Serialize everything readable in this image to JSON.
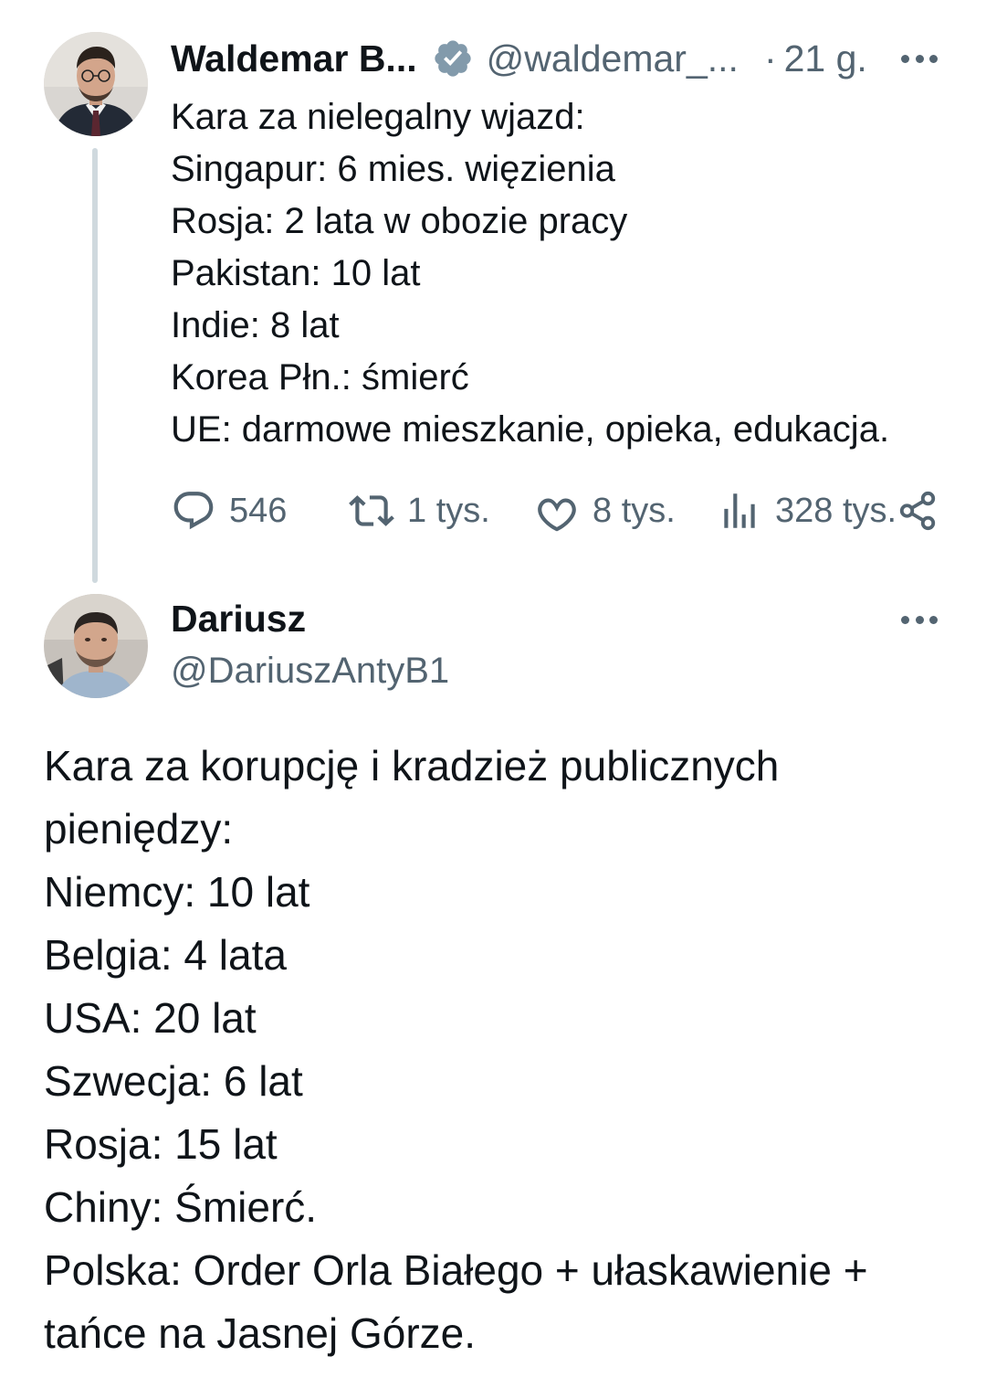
{
  "tweet1": {
    "author_name": "Waldemar B...",
    "handle": "@waldemar_...",
    "dot": "·",
    "time": "21 g.",
    "lines": [
      "Kara za nielegalny wjazd:",
      "Singapur: 6 mies. więzienia",
      "Rosja: 2 lata w obozie pracy",
      "Pakistan: 10 lat",
      "Indie: 8 lat",
      "Korea Płn.: śmierć",
      "UE: darmowe mieszkanie, opieka, edukacja."
    ],
    "replies": "546",
    "retweets": "1 tys.",
    "likes": "8 tys.",
    "views": "328 tys.",
    "icons": [
      "verified-badge-icon",
      "reply-icon",
      "retweet-icon",
      "like-icon",
      "views-icon",
      "share-icon",
      "more-icon"
    ]
  },
  "tweet2": {
    "author_name": "Dariusz",
    "handle": "@DariuszAntyB1",
    "lines": [
      "Kara za korupcję i kradzież publicznych",
      "pieniędzy:",
      "Niemcy: 10 lat",
      "Belgia: 4 lata",
      "USA: 20 lat",
      "Szwecja: 6 lat",
      "Rosja: 15 lat",
      "Chiny: Śmierć.",
      "Polska: Order Orla Białego + ułaskawienie +",
      "tańce na Jasnej Górze."
    ]
  },
  "colors": {
    "text": "#0f1419",
    "secondary": "#536471",
    "verified": "#829aab",
    "thread_line": "#cfd9de"
  }
}
